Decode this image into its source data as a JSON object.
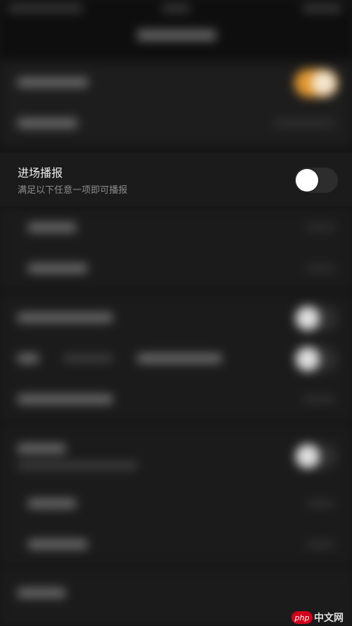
{
  "broadcast_on_entry": {
    "title": "进场播报",
    "subtitle": "满足以下任意一项即可播报",
    "enabled": false
  },
  "watermark": {
    "logo": "php",
    "text": "中文网"
  }
}
